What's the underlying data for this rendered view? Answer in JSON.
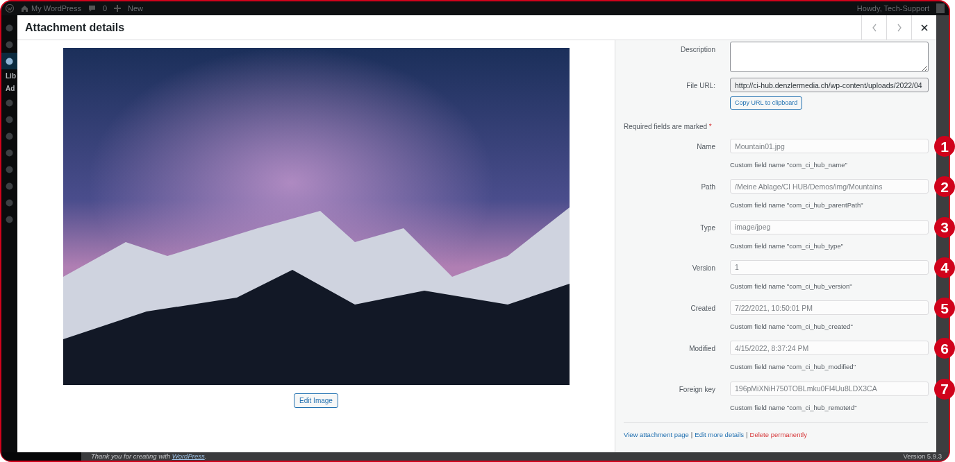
{
  "admin_bar": {
    "site_name": "My WordPress",
    "comments": "0",
    "new_label": "New",
    "greeting": "Howdy, Tech-Support"
  },
  "sidebar": {
    "items": [
      {
        "kind": "icon",
        "selected": false
      },
      {
        "kind": "icon",
        "selected": false
      },
      {
        "kind": "icon",
        "selected": true
      },
      {
        "kind": "text",
        "label": "Lib",
        "selected": false
      },
      {
        "kind": "text",
        "label": "Ad",
        "selected": false
      },
      {
        "kind": "icon",
        "selected": false
      },
      {
        "kind": "icon",
        "selected": false
      },
      {
        "kind": "icon",
        "selected": false
      },
      {
        "kind": "icon",
        "selected": false
      },
      {
        "kind": "icon",
        "selected": false
      },
      {
        "kind": "icon",
        "selected": false
      },
      {
        "kind": "icon",
        "selected": false
      },
      {
        "kind": "icon",
        "selected": false
      }
    ]
  },
  "modal": {
    "title": "Attachment details",
    "image": {
      "edit_button": "Edit Image"
    },
    "details": {
      "description": {
        "label": "Description"
      },
      "file_url": {
        "label": "File URL:",
        "value": "http://ci-hub.denzlermedia.ch/wp-content/uploads/2022/04",
        "copy_button": "Copy URL to clipboard"
      },
      "required_note": "Required fields are marked",
      "required_mark": "*",
      "fields": [
        {
          "label": "Name",
          "value": "Mountain01.jpg",
          "hint": "Custom field name \"com_ci_hub_name\"",
          "disabled": true,
          "badge": "1"
        },
        {
          "label": "Path",
          "value": "/Meine Ablage/CI HUB/Demos/img/Mountains",
          "hint": "Custom field name \"com_ci_hub_parentPath\"",
          "disabled": true,
          "badge": "2"
        },
        {
          "label": "Type",
          "value": "image/jpeg",
          "hint": "Custom field name \"com_ci_hub_type\"",
          "disabled": true,
          "badge": "3"
        },
        {
          "label": "Version",
          "value": "1",
          "hint": "Custom field name \"com_ci_hub_version\"",
          "disabled": true,
          "badge": "4"
        },
        {
          "label": "Created",
          "value": "7/22/2021, 10:50:01 PM",
          "hint": "Custom field name \"com_ci_hub_created\"",
          "disabled": true,
          "badge": "5"
        },
        {
          "label": "Modified",
          "value": "4/15/2022, 8:37:24 PM",
          "hint": "Custom field name \"com_ci_hub_modified\"",
          "disabled": true,
          "badge": "6"
        },
        {
          "label": "Foreign key",
          "value": "196pMiXNiH750TOBLmku0FI4Uu8LDX3CA",
          "hint": "Custom field name \"com_ci_hub_remoteId\"",
          "disabled": true,
          "badge": "7"
        }
      ],
      "actions": [
        {
          "kind": "link",
          "text": "View attachment page"
        },
        {
          "kind": "separator",
          "text": "|"
        },
        {
          "kind": "link",
          "text": "Edit more details"
        },
        {
          "kind": "separator",
          "text": "|"
        },
        {
          "kind": "danger",
          "text": "Delete permanently"
        }
      ]
    }
  },
  "footer": {
    "thanks": "Thank you for creating with ",
    "link": "WordPress",
    "after": ".",
    "version": "Version 5.9.3"
  }
}
